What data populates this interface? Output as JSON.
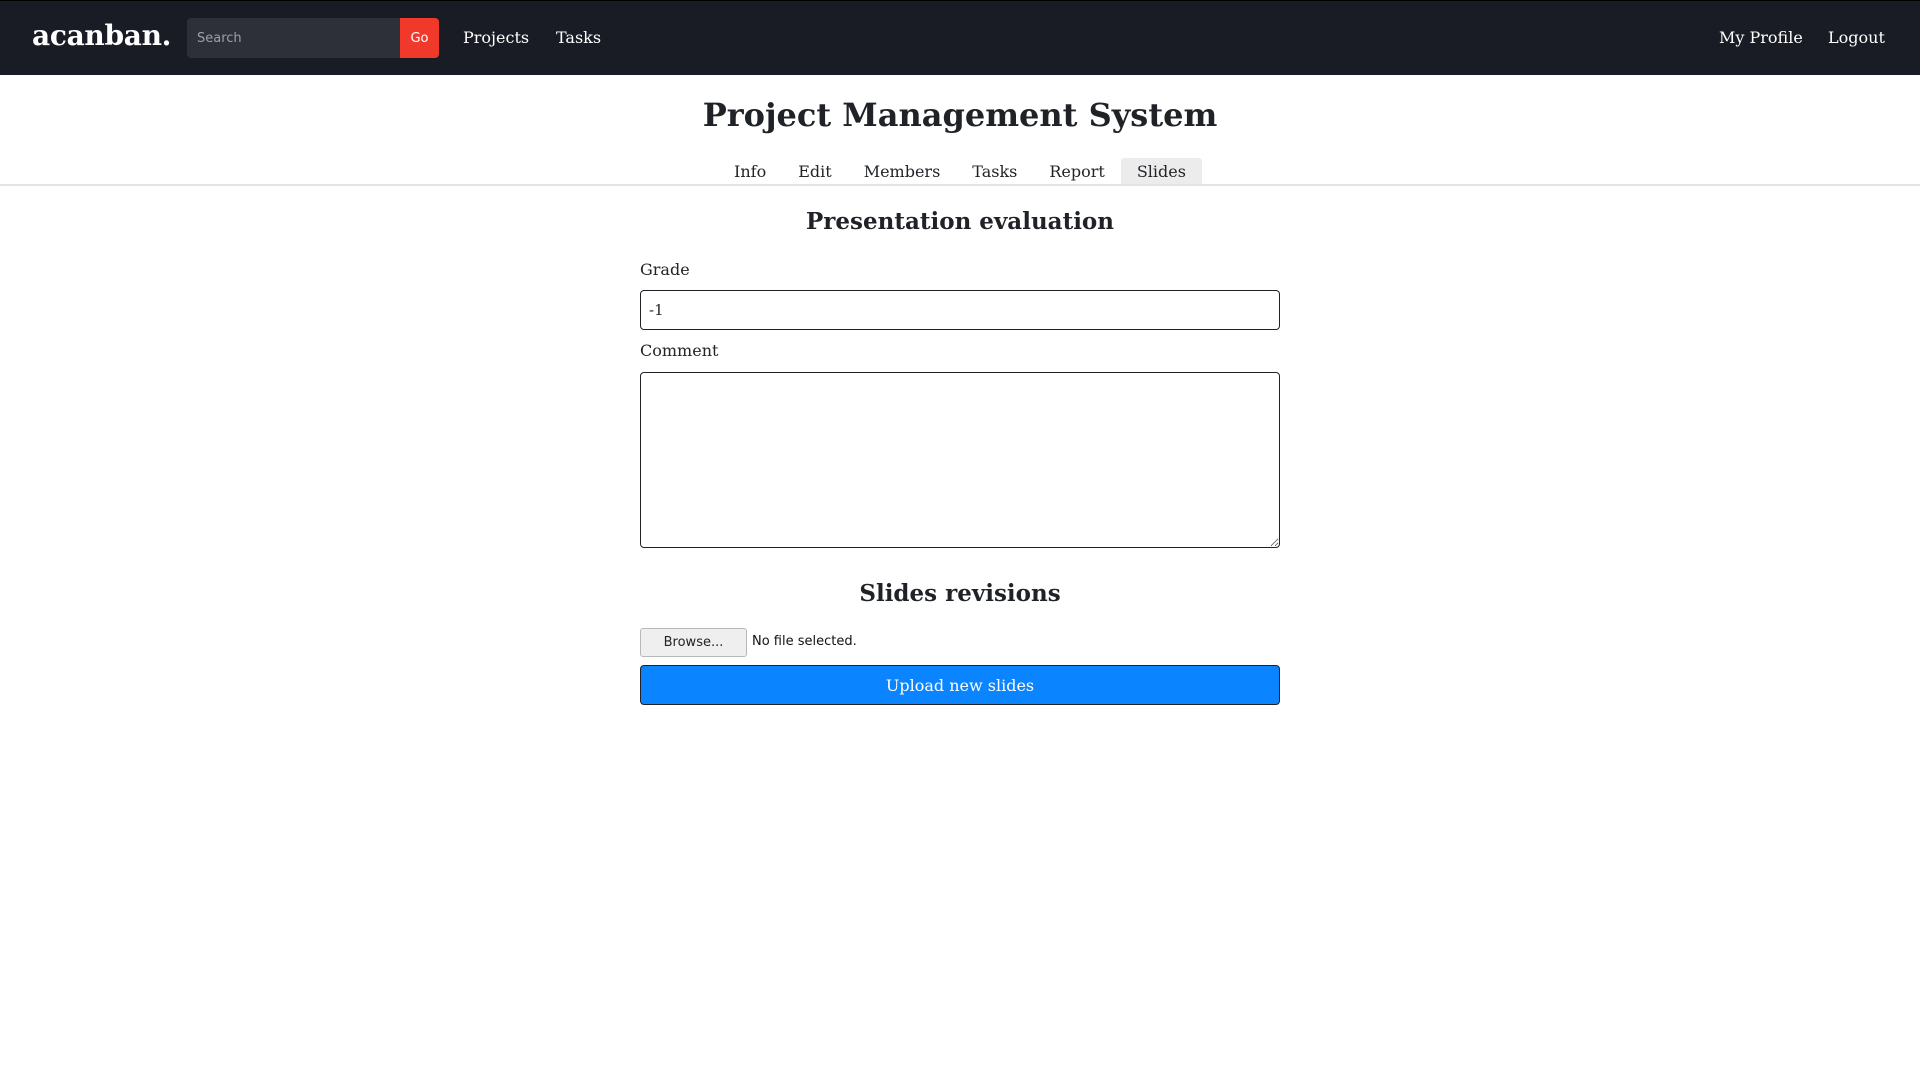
{
  "navbar": {
    "brand": "acanban.",
    "search": {
      "placeholder": "Search",
      "value": ""
    },
    "go_label": "Go",
    "links": {
      "projects": "Projects",
      "tasks": "Tasks",
      "profile": "My Profile",
      "logout": "Logout"
    }
  },
  "page": {
    "title": "Project Management System",
    "tabs": [
      "Info",
      "Edit",
      "Members",
      "Tasks",
      "Report",
      "Slides"
    ],
    "active_tab": "Slides"
  },
  "evaluation": {
    "heading": "Presentation evaluation",
    "grade_label": "Grade",
    "grade_value": "-1",
    "comment_label": "Comment",
    "comment_value": ""
  },
  "slides": {
    "heading": "Slides revisions",
    "browse_label": "Browse...",
    "file_status": "No file selected.",
    "upload_label": "Upload new slides"
  },
  "colors": {
    "navbar_bg": "#191c24",
    "go_button": "#f0392b",
    "upload_button": "#0a84ff",
    "active_tab_bg": "#ececec"
  }
}
